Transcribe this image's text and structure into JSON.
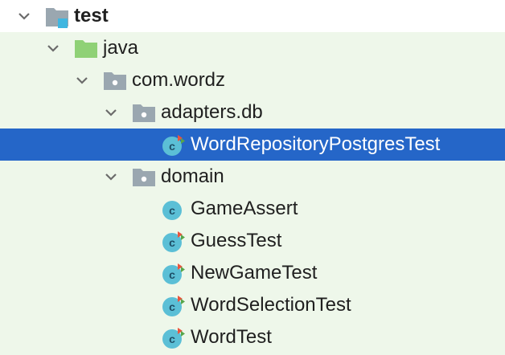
{
  "project_tree": {
    "accent_selected": "#2566c8",
    "test_bg": "#eef7ea",
    "items": [
      {
        "label": "test",
        "icon": "test-folder-icon",
        "expanded": true
      },
      {
        "label": "java",
        "icon": "source-root-folder-icon",
        "expanded": true
      },
      {
        "label": "com.wordz",
        "icon": "package-icon",
        "expanded": true
      },
      {
        "label": "adapters.db",
        "icon": "package-icon",
        "expanded": true
      },
      {
        "label": "WordRepositoryPostgresTest",
        "icon": "test-class-icon",
        "selected": true
      },
      {
        "label": "domain",
        "icon": "package-icon",
        "expanded": true
      },
      {
        "label": "GameAssert",
        "icon": "test-class-icon"
      },
      {
        "label": "GuessTest",
        "icon": "test-class-icon"
      },
      {
        "label": "NewGameTest",
        "icon": "test-class-icon"
      },
      {
        "label": "WordSelectionTest",
        "icon": "test-class-icon"
      },
      {
        "label": "WordTest",
        "icon": "test-class-icon"
      }
    ]
  }
}
